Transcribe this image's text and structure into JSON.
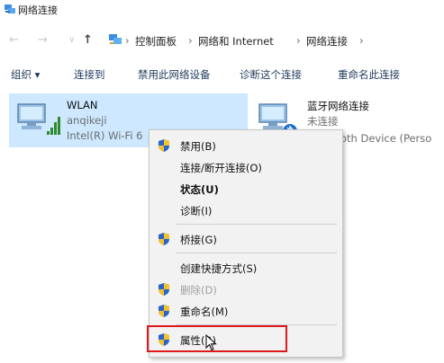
{
  "window": {
    "title": "网络连接"
  },
  "address": {
    "crumbs": [
      "控制面板",
      "网络和 Internet",
      "网络连接"
    ],
    "nav": {
      "back": "←",
      "forward": "→",
      "recent": "∨",
      "up": "↑"
    },
    "separator": "›"
  },
  "toolbar": {
    "organize": "组织 ▾",
    "connect_to": "连接到",
    "disable_device": "禁用此网络设备",
    "diagnose": "诊断这个连接",
    "rename": "重命名此连接"
  },
  "items": [
    {
      "name": "WLAN",
      "line2": "anqikeji",
      "line3": "Intel(R) Wi-Fi 6"
    },
    {
      "name": "蓝牙网络连接",
      "line2": "未连接",
      "line3": "oth Device (Perso"
    }
  ],
  "context_menu": {
    "disable": "禁用(B)",
    "connect": "连接/断开连接(O)",
    "status": "状态(U)",
    "diagnose": "诊断(I)",
    "bridge": "桥接(G)",
    "shortcut": "创建快捷方式(S)",
    "delete": "删除(D)",
    "rename": "重命名(M)",
    "properties": "属性(R)"
  },
  "colors": {
    "selection": "#cde8ff",
    "highlight_border": "#e0191c",
    "toolbar_text": "#1f3a5c"
  }
}
